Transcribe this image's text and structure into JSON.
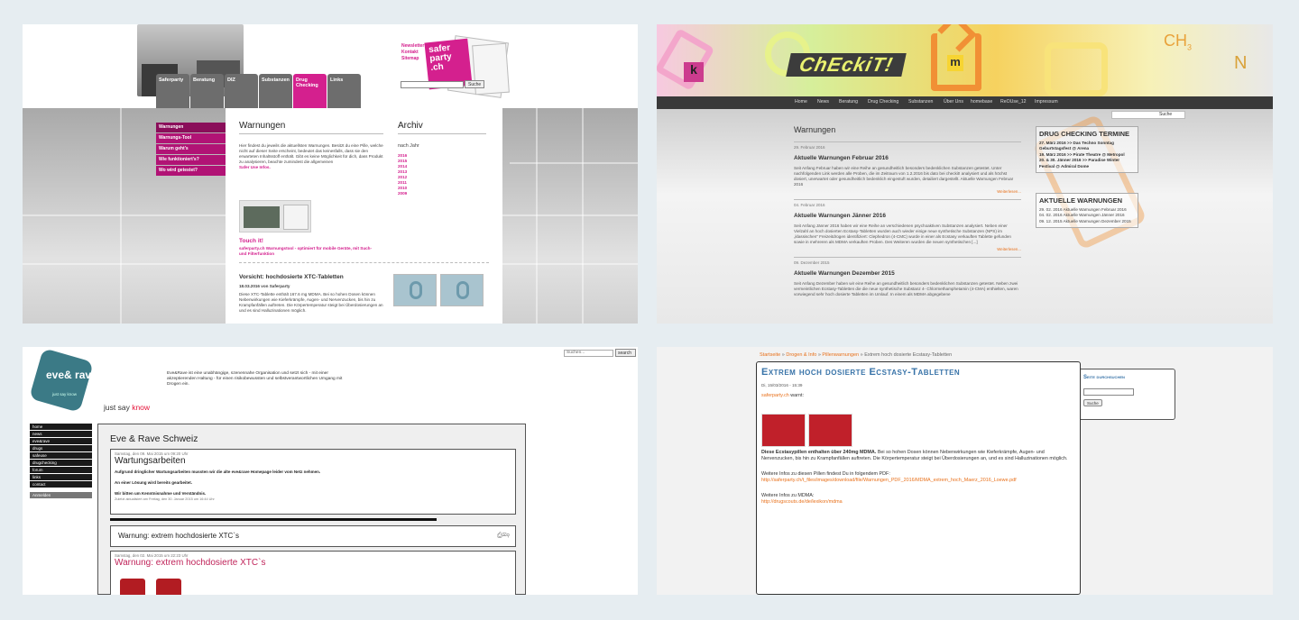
{
  "p1": {
    "nav": [
      "Saferparty",
      "Beratung",
      "DIZ",
      "Substanzen",
      "Drug Checking",
      "Links"
    ],
    "toplinks": [
      "Newsletter",
      "Kontakt",
      "Sitemap"
    ],
    "logo": "safer party .ch",
    "search_btn": "Suche",
    "sidebar": [
      "Warnungen",
      "Warnungs-Tool",
      "Warum geht's",
      "Wie funktioniert's?",
      "Wo wird getestet?"
    ],
    "title": "Warnungen",
    "intro": "Hier findest du jeweils die aktuellsten Warnungen. Besitzt du eine Pille, welche nicht auf dieser Seite erscheint, bedeutet das keinesfalls, dass sie den erwarteten Inhaltsstoff enthält. Gibt es keine Möglichkeit für dich, dass Produkt zu analysieren, beachte zumindest die allgemeinen",
    "intro_link": "Safer Use Infos.",
    "touch": "Touch it!",
    "touch_sub": "saferparty.ch Warnungstool - optimiert für mobile Geräte, mit Such- und Filterfunktion",
    "archiv": "Archiv",
    "nach_jahr": "nach Jahr",
    "years": [
      "2016",
      "2015",
      "2014",
      "2013",
      "2012",
      "2011",
      "2010",
      "2009"
    ],
    "post_title": "Vorsicht: hochdosierte XTC-Tabletten",
    "post_date": "18.03.2016 von Saferparty",
    "post_text": "Diese XTC-Tablette enthält 167.6 mg MDMA. Bei so hohen Dosen können Nebenwirkungen wie Kieferkrämpfe, Augen- und Nervenzucken, bis hin zu Krampfanfällen auftreten. Die Körpertemperatur steigt bei Überdosierungen an und es sind Halluzinationen möglich."
  },
  "p2": {
    "logo": "ChEckiT!",
    "nav": [
      "Home",
      "News",
      "Beratung",
      "Drug Checking",
      "Substanzen",
      "Über Uns",
      "homebase",
      "ReOUse_12",
      "Impressum"
    ],
    "search_btn": "Suche",
    "title": "Warnungen",
    "posts": [
      {
        "date": "29. Februar 2016",
        "title": "Aktuelle Warnungen Februar 2016",
        "text": "Seit Anfang Februar haben wir eine Reihe an gesundheitlich besonders bedenklichen Substanzen getestet. Unter nachfolgenden Link werden alle Proben, die im Zeitraum von 1.2.2016 bis dato bei checkit! analysiert und als höchst dosiert, unerwartet oder gesundheitlich bedenklich eingestuft wurden, detailiert dargestellt. Aktuelle Warnungen Februar 2016",
        "more": "Weiterlesen..."
      },
      {
        "date": "04. Februar 2016",
        "title": "Aktuelle Warnungen Jänner 2016",
        "text": "Seit Anfang Jänner 2016 haben wir eine Reihe an verschiedenen psychoaktiven Substanzen analysiert. Neben einer Vielzahl an hoch dosierten Ecstasy-Tabletten wurden auch wieder einige neue synthetische Substanzen (NPS) im „klassischen“ Freizeitdrogen identifiziert: Clephedron (4-CMC) wurde in einer als Ecstasy verkauften Tablette gefunden sowie in mehreren als MDMA verkauften Proben. Des Weiteren wurden die neuen synthetischen [...]",
        "more": "Weiterlesen..."
      },
      {
        "date": "09. Dezember 2015",
        "title": "Aktuelle Warnungen Dezember 2015",
        "text": "Seit Anfang Dezember haben wir eine Reihe an gesundheitlich besonders bedenklichen Substanzen getestet. Neben zwei vermeintlichen Ecstasy-Tabletten die die neue synthetische Substanz 4- Chlormethamphetamin (4-CMA) enthielten, waren vorwiegend sehr hoch dosierte Tabletten im Umlauf. In einem als MDMA abgegebene",
        "more": ""
      }
    ],
    "box1_title": "DRUG CHECKING TERMINE",
    "box1": [
      "27. März 2016 >> Das Techno Sonntag Geburtstagsfest @ Arena",
      "19. März 2016 >> Pirate Theatre @ Metropol",
      "20. & 30. Jänner 2016 >> Paradise Winter Festival @ Admiral Dome"
    ],
    "box2_title": "AKTUELLE WARNUNGEN",
    "box2": [
      "29. 02. 2016 Aktuelle Warnungen Februar 2016",
      "04. 02. 2016 Aktuelle Warnungen Jänner 2016",
      "09. 12. 2015 Aktuelle Warnungen Dezember 2015"
    ]
  },
  "p3": {
    "logo": "eve& rave",
    "logo_sub": "just say know",
    "tagline1": "just say",
    "tagline2": "know",
    "intro": "Eve&Rave ist eine unabhängige, szenennahe Organisation und setzt sich - mit einer akzeptierenden Haltung - für einen risikobewussten und selbstverantwortlichen Umgang mit Drogen ein.",
    "search_placeholder": "Suchen...",
    "search_btn": "search",
    "menu": [
      "home",
      "news",
      "eve&rave",
      "drugs",
      "safeuse",
      "drugchecking",
      "forum",
      "links",
      "contact"
    ],
    "login": "Anmelden",
    "title": "Eve & Rave Schweiz",
    "post1_date": "Samstag, den 09. Mai 2015 um 09:20 Uhr",
    "post1_title": "Wartungsarbeiten",
    "post1_l1": "Aufgrund dringlicher Wartungsarbeiten mussten wir die alte eve&rave Homepage leider vom Netz nehmen.",
    "post1_l2": "An einer Lösung wird bereits gearbeitet.",
    "post1_l3": "Wir bitten um Kenntnisnahme und Verständnis.",
    "post1_foot": "Zuletzt aktualisiert am Freitag, den 30. Januar 2015 um 16:44 Uhr",
    "post2_title": "Warnung: extrem hochdosierte XTC`s",
    "post3_date": "Samstag, den 02. Mai 2015 um 22:23 Uhr",
    "post3_title": "Warnung: extrem hochdosierte XTC`s"
  },
  "p4": {
    "crumb1": "Startseite",
    "crumb2": "Drogen & Info",
    "crumb3": "Pillenwarnungen",
    "crumb4": "Extrem hoch dosierte Ecstasy-Tabletten",
    "sep": " » ",
    "title": "Extrem hoch dosierte Ecstasy-Tabletten",
    "date": "Di, 15/03/2016 - 15:39",
    "source_link": "saferparty.ch",
    "source_rest": " warnt:",
    "p1_bold": "Diese Ecstasypillen enthalten über 240mg MDMA.",
    "p1_rest": " Bei so hohen Dosen können Nebenwirkungen wie Kieferkrämpfe, Augen- und Nervenzucken, bis hin zu Krampfanfällen auftreten. Die Körpertemperatur steigt bei Überdosierungen an, und es sind Halluzinationen möglich.",
    "p2": "Weitere Infos zu diesen Pillen findest Du in folgendem PDF:",
    "p2_link": "http://saferparty.ch/t_files/images/download/file/Warnungen_PDF_2016/MDMA_extrem_hoch_Maerz_2016_Loewe.pdf",
    "p3": "Weitere Infos zu MDMA:",
    "p3_link": "http://drugscouts.de/de/lexikon/mdma",
    "side_title": "Seite durchsuchen",
    "side_btn": "Suche"
  }
}
